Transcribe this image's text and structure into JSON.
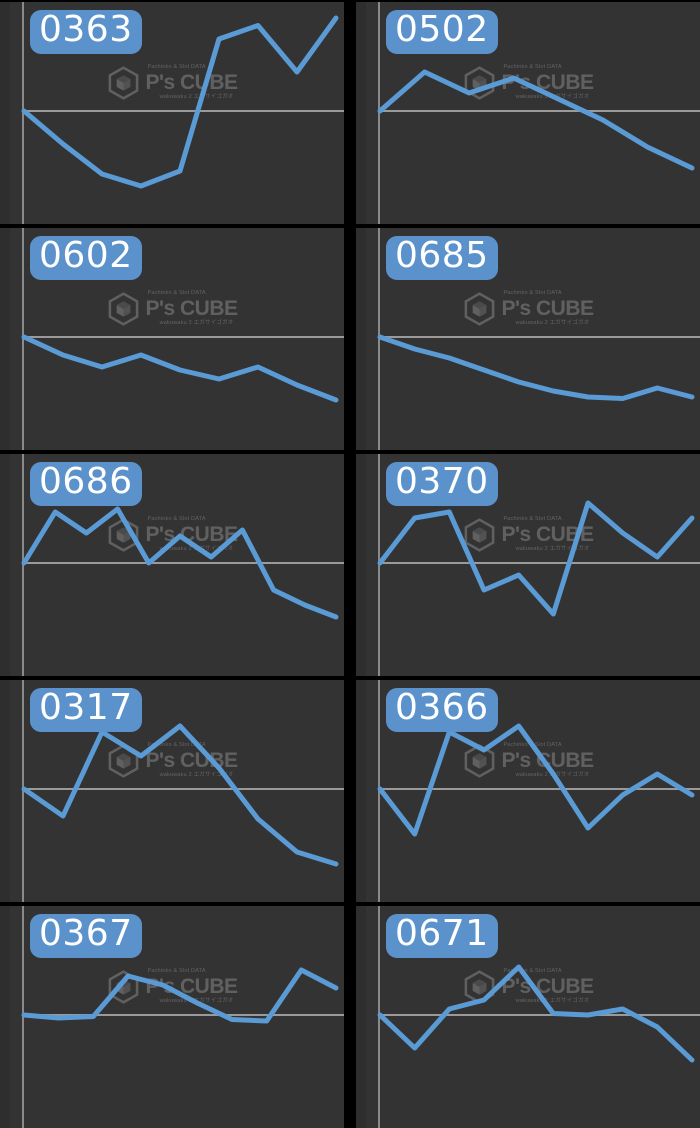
{
  "theme": {
    "page_background": "#000000",
    "card_background": "#333333",
    "badge_color": "#5b92cc",
    "badge_text_color": "#ffffff",
    "line_color": "#5a9bd5",
    "axis_color": "#8a8a8a",
    "baseline_color": "#9a9a9a"
  },
  "watermark": {
    "top_text": "Pachinko & Slot DATA",
    "main_text": "P's CUBE",
    "bottom_text": "wakuwaku 2 エガサイゴガオ",
    "logo_icon": "hexagon-cube-logo-icon"
  },
  "grid": {
    "columns": 2,
    "rows": 5
  },
  "chart_data": [
    {
      "type": "line",
      "id": "0363",
      "title": "0363",
      "x": [
        0,
        1,
        2,
        3,
        4,
        5,
        6,
        7,
        8
      ],
      "values": [
        0,
        -22,
        -42,
        -50,
        -40,
        48,
        57,
        26,
        62
      ],
      "ylim": [
        -70,
        70
      ],
      "baseline": 0,
      "grid": false,
      "legend": "none"
    },
    {
      "type": "line",
      "id": "0502",
      "title": "0502",
      "x": [
        0,
        1,
        2,
        3,
        4,
        5,
        6,
        7
      ],
      "values": [
        0,
        26,
        12,
        22,
        8,
        -6,
        -24,
        -38
      ],
      "ylim": [
        -70,
        70
      ],
      "baseline": 0,
      "grid": false,
      "legend": "none"
    },
    {
      "type": "line",
      "id": "0602",
      "title": "0602",
      "x": [
        0,
        1,
        2,
        3,
        4,
        5,
        6,
        7,
        8
      ],
      "values": [
        0,
        -12,
        -20,
        -12,
        -22,
        -28,
        -20,
        -32,
        -42
      ],
      "ylim": [
        -70,
        70
      ],
      "baseline": 0,
      "grid": false,
      "legend": "none"
    },
    {
      "type": "line",
      "id": "0685",
      "title": "0685",
      "x": [
        0,
        1,
        2,
        3,
        4,
        5,
        6,
        7,
        8,
        9
      ],
      "values": [
        0,
        -8,
        -14,
        -22,
        -30,
        -36,
        -40,
        -41,
        -34,
        -40
      ],
      "ylim": [
        -70,
        70
      ],
      "baseline": 0,
      "grid": false,
      "legend": "none"
    },
    {
      "type": "line",
      "id": "0686",
      "title": "0686",
      "x": [
        0,
        1,
        2,
        3,
        4,
        5,
        6,
        7,
        8,
        9,
        10
      ],
      "values": [
        0,
        34,
        20,
        36,
        0,
        18,
        4,
        22,
        -18,
        -28,
        -36
      ],
      "ylim": [
        -70,
        70
      ],
      "baseline": 0,
      "grid": false,
      "legend": "none"
    },
    {
      "type": "line",
      "id": "0370",
      "title": "0370",
      "x": [
        0,
        1,
        2,
        3,
        4,
        5,
        6,
        7,
        8,
        9
      ],
      "values": [
        0,
        30,
        34,
        -18,
        -8,
        -34,
        40,
        20,
        4,
        30
      ],
      "ylim": [
        -70,
        70
      ],
      "baseline": 0,
      "grid": false,
      "legend": "none"
    },
    {
      "type": "line",
      "id": "0317",
      "title": "0317",
      "x": [
        0,
        1,
        2,
        3,
        4,
        5,
        6,
        7,
        8
      ],
      "values": [
        0,
        -18,
        38,
        22,
        42,
        14,
        -20,
        -42,
        -50
      ],
      "ylim": [
        -70,
        70
      ],
      "baseline": 0,
      "grid": false,
      "legend": "none"
    },
    {
      "type": "line",
      "id": "0366",
      "title": "0366",
      "x": [
        0,
        1,
        2,
        3,
        4,
        5,
        6,
        7,
        8,
        9
      ],
      "values": [
        0,
        -30,
        38,
        26,
        42,
        10,
        -26,
        -4,
        10,
        -4
      ],
      "ylim": [
        -70,
        70
      ],
      "baseline": 0,
      "grid": false,
      "legend": "none"
    },
    {
      "type": "line",
      "id": "0367",
      "title": "0367",
      "x": [
        0,
        1,
        2,
        3,
        4,
        5,
        6,
        7,
        8,
        9
      ],
      "values": [
        0,
        -2,
        -1,
        26,
        20,
        8,
        -3,
        -4,
        30,
        18
      ],
      "ylim": [
        -70,
        70
      ],
      "baseline": 0,
      "grid": false,
      "legend": "none"
    },
    {
      "type": "line",
      "id": "0671",
      "title": "0671",
      "x": [
        0,
        1,
        2,
        3,
        4,
        5,
        6,
        7,
        8,
        9
      ],
      "values": [
        0,
        -22,
        4,
        10,
        32,
        1,
        0,
        4,
        -8,
        -30
      ],
      "ylim": [
        -70,
        70
      ],
      "baseline": 0,
      "grid": false,
      "legend": "none"
    }
  ]
}
